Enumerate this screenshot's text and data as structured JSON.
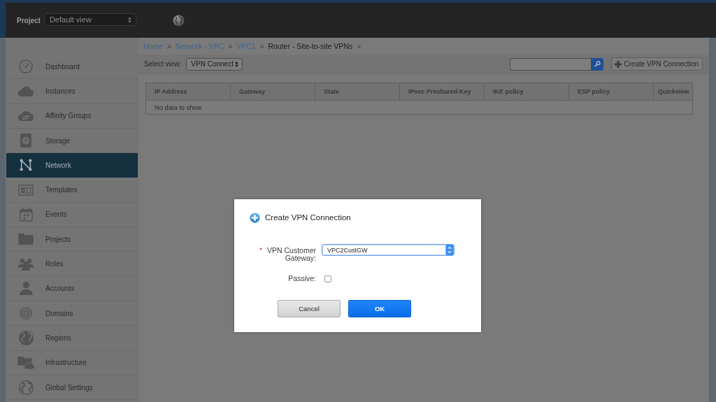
{
  "header": {
    "project_label": "Project",
    "project_view": "Default view"
  },
  "sidebar": {
    "items": [
      {
        "label": "Dashboard",
        "selected": false
      },
      {
        "label": "Instances",
        "selected": false
      },
      {
        "label": "Affinity Groups",
        "selected": false
      },
      {
        "label": "Storage",
        "selected": false
      },
      {
        "label": "Network",
        "selected": true
      },
      {
        "label": "Templates",
        "selected": false
      },
      {
        "label": "Events",
        "selected": false
      },
      {
        "label": "Projects",
        "selected": false
      },
      {
        "label": "Roles",
        "selected": false
      },
      {
        "label": "Accounts",
        "selected": false
      },
      {
        "label": "Domains",
        "selected": false
      },
      {
        "label": "Regions",
        "selected": false
      },
      {
        "label": "Infrastructure",
        "selected": false
      },
      {
        "label": "Global Settings",
        "selected": false
      }
    ]
  },
  "breadcrumb": [
    {
      "label": "Home",
      "kind": "link",
      "separator": ">"
    },
    {
      "label": "Network - VPC",
      "kind": "link",
      "separator": ">"
    },
    {
      "label": "VPC1",
      "kind": "link",
      "separator": ">"
    },
    {
      "label": "Router - Site-to-site VPNs",
      "kind": "current",
      "separator": ">"
    }
  ],
  "toolbar": {
    "select_view_label": "Select view:",
    "view_select": "VPN Connect",
    "create_button": "Create VPN Connection"
  },
  "table": {
    "columns": [
      "IP Address",
      "Gateway",
      "State",
      "IPsec Preshared-Key",
      "IKE policy",
      "ESP policy",
      "Quickview"
    ],
    "empty_message": "No data to show"
  },
  "dialog": {
    "title": "Create VPN Connection",
    "fields": [
      {
        "kind": "select",
        "required_mark": "*",
        "label": "VPN Customer Gateway:",
        "value": "VPC2CustGW"
      },
      {
        "kind": "checkbox",
        "label": "Passive:",
        "checked": false
      }
    ],
    "buttons": [
      {
        "label": "Cancel",
        "kind": "secondary"
      },
      {
        "label": "OK",
        "kind": "primary"
      }
    ]
  }
}
